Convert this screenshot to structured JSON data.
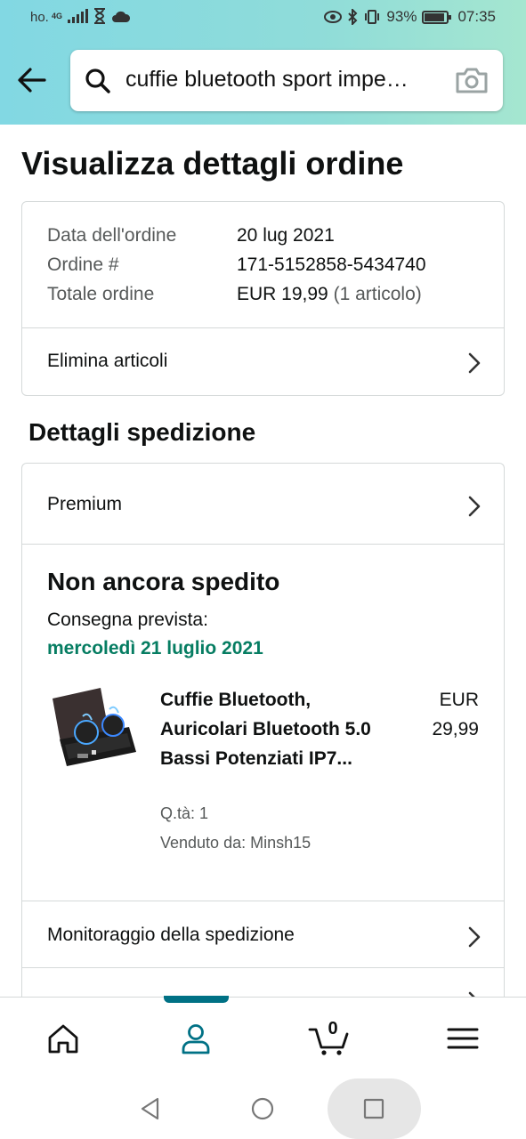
{
  "status_bar": {
    "carrier": "ho.",
    "network": "4G",
    "battery_percent": "93%",
    "time": "07:35"
  },
  "search": {
    "query": "cuffie bluetooth sport impe…",
    "icons": [
      "back-arrow-icon",
      "search-icon",
      "camera-icon"
    ]
  },
  "page_title": "Visualizza dettagli ordine",
  "order": {
    "date_label": "Data dell'ordine",
    "date_value": "20 lug 2021",
    "number_label": "Ordine #",
    "number_value": "171-5152858-5434740",
    "total_label": "Totale ordine",
    "total_value": "EUR 19,99",
    "total_items": "(1 articolo)",
    "delete_items": "Elimina articoli"
  },
  "shipping": {
    "section_title": "Dettagli spedizione",
    "premium": "Premium",
    "status": "Non ancora spedito",
    "delivery_label": "Consegna prevista:",
    "delivery_date": "mercoledì 21 luglio 2021",
    "delivery_date_color": "#067d62",
    "product": {
      "title": "Cuffie Bluetooth, Auricolari Bluetooth 5.0 Bassi Potenziati IP7...",
      "price_currency": "EUR",
      "price_value": "29,99",
      "qty": "Q.tà: 1",
      "seller": "Venduto da: Minsh15"
    },
    "tracking": "Monitoraggio della spedizione"
  },
  "bottom_nav": {
    "items": [
      "home-icon",
      "account-icon",
      "cart-icon",
      "menu-icon"
    ],
    "cart_count": "0",
    "active_color": "#007185"
  }
}
